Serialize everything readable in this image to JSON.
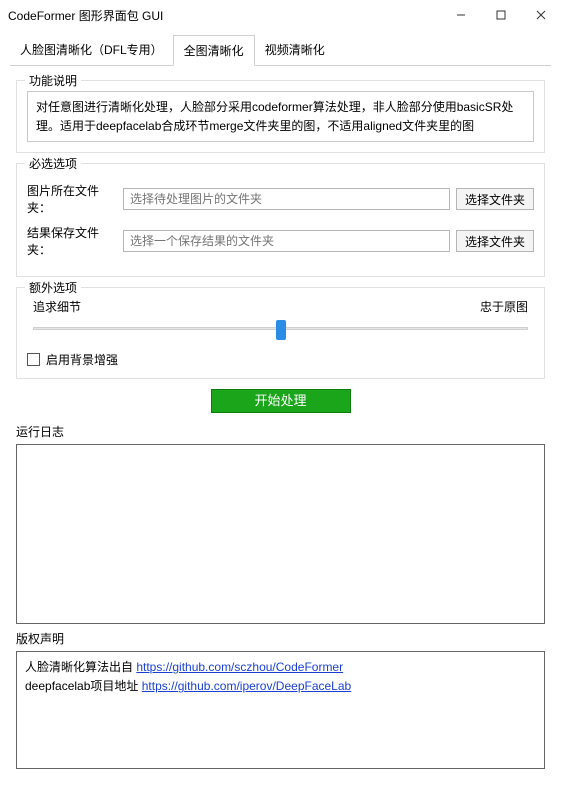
{
  "window": {
    "title": "CodeFormer 图形界面包 GUI"
  },
  "tabs": {
    "dfl": "人脸图清晰化（DFL专用）",
    "whole": "全图清晰化",
    "video": "视频清晰化"
  },
  "groups": {
    "desc_title": "功能说明",
    "desc_text": "对任意图进行清晰化处理，人脸部分采用codeformer算法处理，非人脸部分使用basicSR处理。适用于deepfacelab合成环节merge文件夹里的图，不适用aligned文件夹里的图",
    "required_title": "必选选项",
    "input_label": "图片所在文件夹：",
    "input_placeholder": "选择待处理图片的文件夹",
    "output_label": "结果保存文件夹：",
    "output_placeholder": "选择一个保存结果的文件夹",
    "browse_btn": "选择文件夹",
    "extra_title": "额外选项",
    "slider_left": "追求细节",
    "slider_right": "忠于原图",
    "bg_enhance": "启用背景增强"
  },
  "actions": {
    "start": "开始处理"
  },
  "log": {
    "title": "运行日志"
  },
  "copyright": {
    "title": "版权声明",
    "line1_prefix": "人脸清晰化算法出自 ",
    "line1_link": "https://github.com/sczhou/CodeFormer",
    "line2_prefix": "deepfacelab项目地址 ",
    "line2_link": "https://github.com/iperov/DeepFaceLab"
  }
}
